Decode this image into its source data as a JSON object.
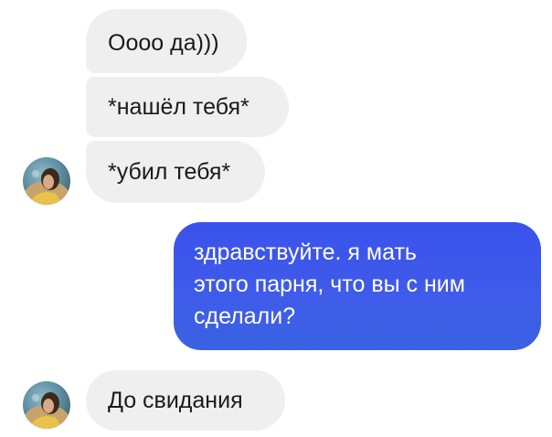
{
  "conversation": {
    "incoming": [
      {
        "text": "Оооо да)))"
      },
      {
        "text": "*нашёл тебя*"
      },
      {
        "text": "*убил тебя*"
      }
    ],
    "outgoing": {
      "lines": [
        "здравствуйте. я мать",
        "этого парня, что вы с ним",
        "сделали?"
      ]
    },
    "reply": {
      "text": "До свидания"
    }
  },
  "colors": {
    "incoming_bubble": "#efefef",
    "outgoing_bubble": "#3f5bea",
    "outgoing_text": "#ffffff",
    "incoming_text": "#1a1a1a"
  },
  "icons": [
    "contact-avatar-icon"
  ]
}
